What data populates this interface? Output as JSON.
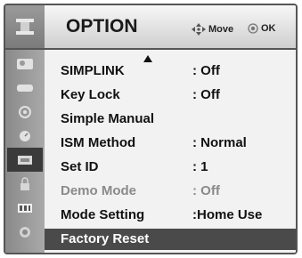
{
  "header": {
    "title": "OPTION",
    "move_hint": "Move",
    "ok_hint": "OK"
  },
  "sidebar": {
    "icons": [
      "picture-icon",
      "audio-icon",
      "time-icon",
      "setup-icon",
      "option-icon",
      "lock-icon",
      "input-icon",
      "usb-icon"
    ],
    "active_index": 4
  },
  "menu": {
    "items": [
      {
        "label": "SIMPLINK",
        "value": ": Off"
      },
      {
        "label": "Key Lock",
        "value": ": Off"
      },
      {
        "label": "Simple Manual",
        "value": ""
      },
      {
        "label": "ISM Method",
        "value": ": Normal"
      },
      {
        "label": "Set ID",
        "value": ": 1"
      },
      {
        "label": "Demo Mode",
        "value": ": Off"
      },
      {
        "label": "Mode Setting",
        "value": ":Home Use"
      },
      {
        "label": "Factory Reset",
        "value": ""
      }
    ]
  },
  "colors": {
    "selected_row": "#4a4a4a",
    "disabled_text": "#8a8a8a"
  }
}
